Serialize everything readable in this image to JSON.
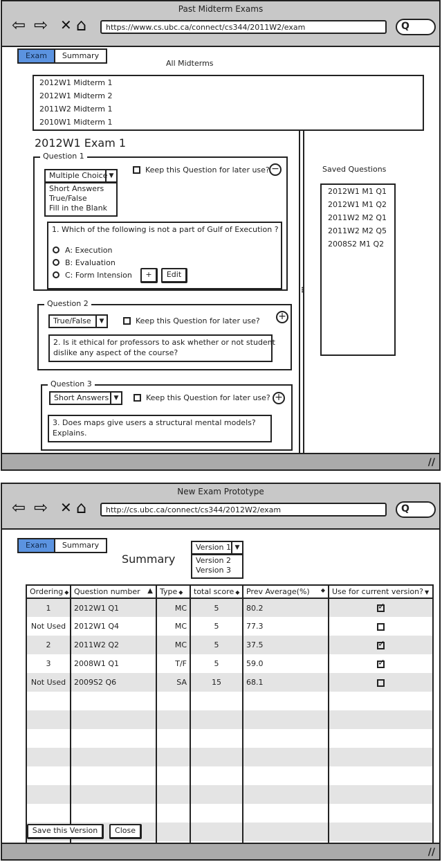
{
  "window1": {
    "title": "Past Midterm Exams",
    "url": "https://www.cs.ubc.ca/connect/cs344/2011W2/exam",
    "tabs": [
      "Exam",
      "Summary"
    ],
    "all_midterms_label": "All Midterms",
    "midterms": [
      "2012W1 Midterm 1",
      "2012W1 Midterm 2",
      "2011W2 Midterm 1",
      "2010W1 Midterm 1"
    ],
    "exam_title": "2012W1 Exam 1",
    "keep_label": "Keep this Question for later use?",
    "q1": {
      "legend": "Question 1",
      "type": "Multiple Choice",
      "type_options": [
        "Short Answers",
        "True/False",
        "Fill in the Blank"
      ],
      "text": "1. Which of the following is not a part of Gulf of Execution ?",
      "choices": [
        "A: Execution",
        "B: Evaluation",
        "C: Form Intension"
      ],
      "add_label": "+",
      "edit_label": "Edit"
    },
    "q2": {
      "legend": "Question 2",
      "type": "True/False",
      "text_line1": "2. Is it ethical for professors to ask whether or not student",
      "text_line2": "dislike any aspect of the course?"
    },
    "q3": {
      "legend": "Question 3",
      "type": "Short Answers",
      "text_line1": "3. Does maps give users a structural mental models?",
      "text_line2": "Explains."
    },
    "saved_title": "Saved Questions",
    "saved": [
      "2012W1 M1 Q1",
      "2012W1 M1 Q2",
      "2011W2 M2 Q1",
      "2011W2 M2 Q5",
      "2008S2 M1 Q2"
    ]
  },
  "window2": {
    "title": "New Exam Prototype",
    "url": "http://cs.ubc.ca/connect/cs344/2012W2/exam",
    "tabs": [
      "Exam",
      "Summary"
    ],
    "heading": "Summary",
    "version_selected": "Version 1",
    "version_options": [
      "Version 2",
      "Version 3"
    ],
    "columns": [
      "Ordering",
      "Question number",
      "Type",
      "total score",
      "Prev Average(%)",
      "Use for current version?"
    ],
    "rows": [
      {
        "order": "1",
        "qnum": "2012W1 Q1",
        "type": "MC",
        "score": "5",
        "avg": "80.2",
        "use": true
      },
      {
        "order": "Not Used",
        "qnum": "2012W1 Q4",
        "type": "MC",
        "score": "5",
        "avg": "77.3",
        "use": false
      },
      {
        "order": "2",
        "qnum": "2011W2 Q2",
        "type": "MC",
        "score": "5",
        "avg": "37.5",
        "use": true
      },
      {
        "order": "3",
        "qnum": "2008W1 Q1",
        "type": "T/F",
        "score": "5",
        "avg": "59.0",
        "use": true
      },
      {
        "order": "Not Used",
        "qnum": "2009S2 Q6",
        "type": "SA",
        "score": "15",
        "avg": "68.1",
        "use": false
      }
    ],
    "save_label": "Save this Version",
    "close_label": "Close"
  },
  "icons": {
    "back": "⇦",
    "forward": "⇨",
    "close": "✕",
    "home": "⌂",
    "search": "Q",
    "grip": "//"
  }
}
